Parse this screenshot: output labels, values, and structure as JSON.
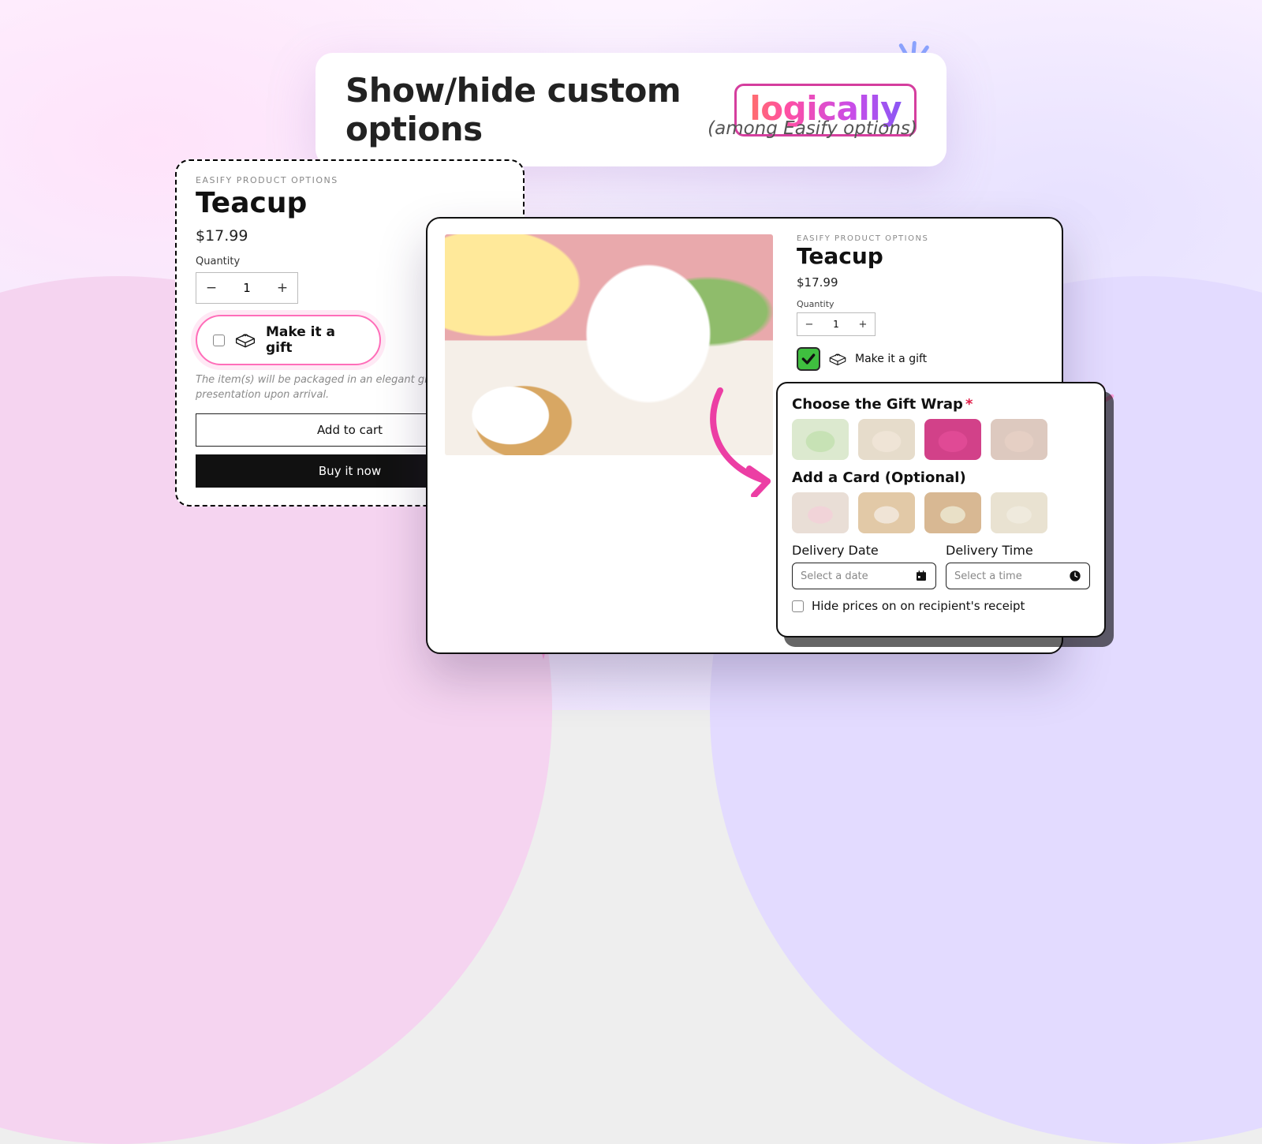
{
  "headline": {
    "plain": "Show/hide custom options",
    "chip": "logically",
    "sub": "(among Easify options)"
  },
  "left": {
    "brand": "EASIFY PRODUCT OPTIONS",
    "title": "Teacup",
    "price": "$17.99",
    "qty_label": "Quantity",
    "qty_value": "1",
    "gift_label": "Make it a gift",
    "desc": "The item(s) will be packaged in an elegant gift a delightful presentation upon arrival.",
    "add": "Add to cart",
    "buy": "Buy it now"
  },
  "right": {
    "brand": "EASIFY PRODUCT OPTIONS",
    "title": "Teacup",
    "price": "$17.99",
    "qty_label": "Quantity",
    "qty_value": "1",
    "gift_label": "Make it a gift"
  },
  "pop": {
    "wrap": "Choose the Gift Wrap",
    "card": "Add a Card (Optional)",
    "date": "Delivery Date",
    "time": "Delivery Time",
    "date_ph": "Select a date",
    "time_ph": "Select a time",
    "hide": "Hide prices on on recipient's receipt"
  }
}
